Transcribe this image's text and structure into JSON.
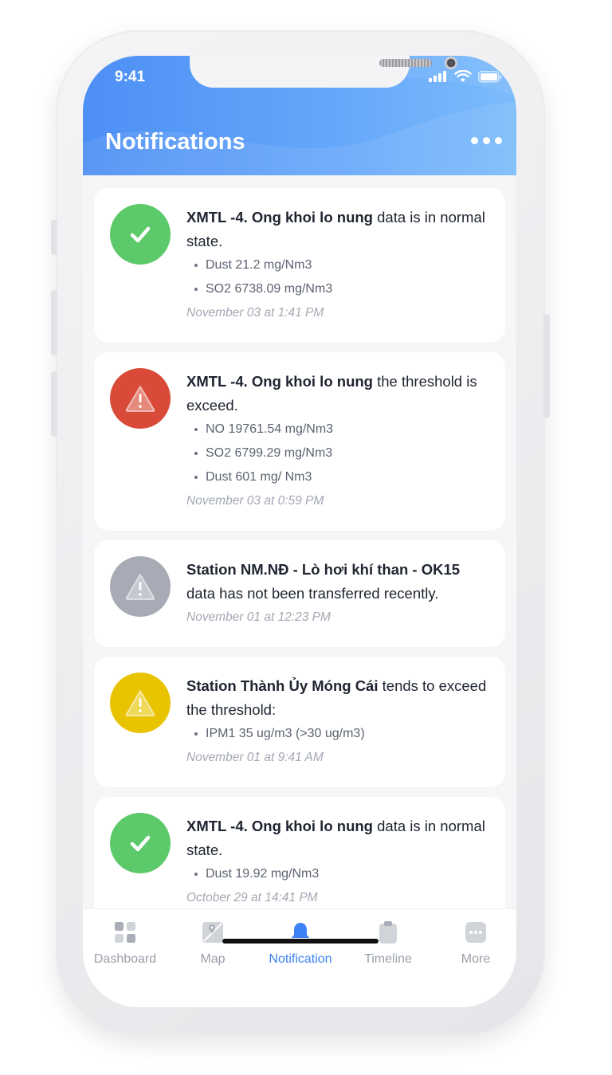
{
  "status_bar": {
    "time": "9:41"
  },
  "header": {
    "title": "Notifications"
  },
  "notifications": [
    {
      "status": "ok",
      "source": "XMTL -4. Ong khoi lo nung",
      "message": " data is in normal state.",
      "details": [
        "Dust 21.2 mg/Nm3",
        "SO2 6738.09 mg/Nm3"
      ],
      "time": "November 03 at 1:41 PM"
    },
    {
      "status": "exceeded",
      "source": "XMTL -4. Ong khoi lo nung",
      "message": " the threshold is exceed.",
      "details": [
        "NO 19761.54 mg/Nm3",
        "SO2 6799.29 mg/Nm3",
        "Dust 601 mg/ Nm3"
      ],
      "time": "November 03 at 0:59 PM"
    },
    {
      "status": "offline",
      "source": "Station NM.NĐ - Lò hơi khí than - OK15",
      "message": " data has not been transferred recently.",
      "details": [],
      "time": "November 01 at 12:23 PM"
    },
    {
      "status": "warning",
      "source": "Station Thành Ủy Móng Cái",
      "message": " tends to exceed the threshold:",
      "details": [
        "IPM1 35 ug/m3 (>30 ug/m3)"
      ],
      "time": "November 01 at 9:41 AM"
    },
    {
      "status": "ok",
      "source": "XMTL -4. Ong khoi lo nung",
      "message": " data is in normal state.",
      "details": [
        "Dust 19.92 mg/Nm3"
      ],
      "time": "October 29 at 14:41 PM"
    }
  ],
  "status_colors": {
    "ok": "#5cc96a",
    "exceeded": "#d94a38",
    "offline": "#a7abb5",
    "warning": "#e8c300"
  },
  "tabbar": {
    "tabs": [
      {
        "label": "Dashboard",
        "icon": "dashboard-icon",
        "active": false
      },
      {
        "label": "Map",
        "icon": "map-icon",
        "active": false
      },
      {
        "label": "Notification",
        "icon": "bell-icon",
        "active": true
      },
      {
        "label": "Timeline",
        "icon": "clipboard-icon",
        "active": false
      },
      {
        "label": "More",
        "icon": "more-icon",
        "active": false
      }
    ]
  }
}
